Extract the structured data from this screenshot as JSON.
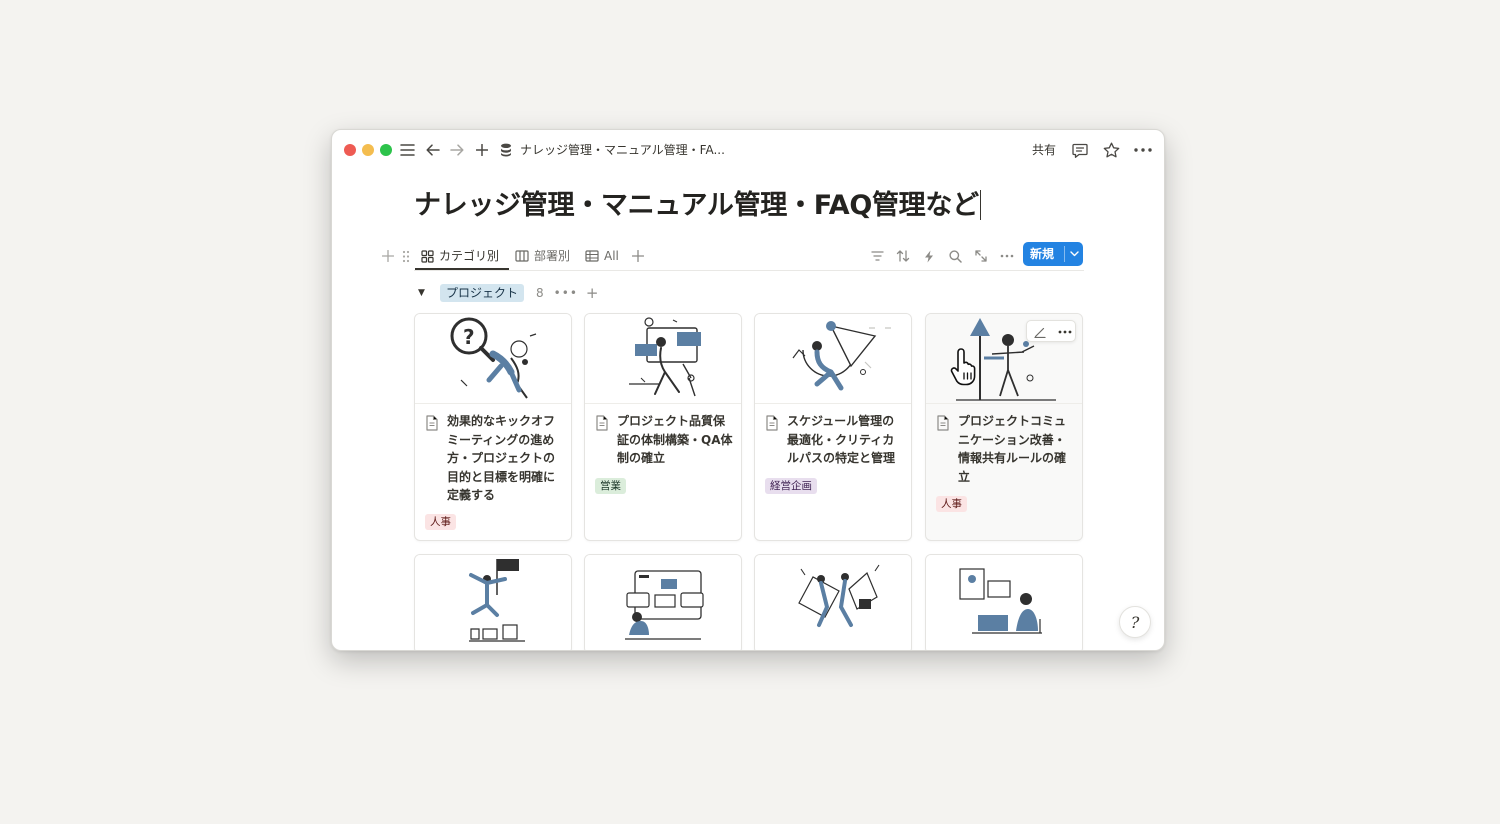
{
  "titlebar": {
    "breadcrumb": "ナレッジ管理・マニュアル管理・FA...",
    "share_label": "共有",
    "icons": [
      "menu-icon",
      "back-arrow-icon",
      "forward-arrow-icon",
      "plus-icon",
      "database-icon",
      "comment-icon",
      "star-icon",
      "more-icon"
    ]
  },
  "page": {
    "title": "ナレッジ管理・マニュアル管理・FAQ管理など"
  },
  "views": {
    "tabs": [
      {
        "label": "カテゴリ別",
        "icon": "gallery-icon",
        "active": true
      },
      {
        "label": "部署別",
        "icon": "board-icon",
        "active": false
      },
      {
        "label": "All",
        "icon": "table-icon",
        "active": false
      }
    ],
    "new_label": "新規",
    "tools": [
      "filter-icon",
      "sort-icon",
      "automation-icon",
      "search-icon",
      "expand-icon",
      "more-icon"
    ]
  },
  "group": {
    "name": "プロジェクト",
    "count": "8"
  },
  "cards": [
    {
      "title": "効果的なキックオフミーティングの進め方・プロジェクトの目的と目標を明確に定義する",
      "tag": "人事",
      "tag_color": "#fbe4e4"
    },
    {
      "title": "プロジェクト品質保証の体制構築・QA体制の確立",
      "tag": "営業",
      "tag_color": "#dbeddb"
    },
    {
      "title": "スケジュール管理の最適化・クリティカルパスの特定と管理",
      "tag": "経営企画",
      "tag_color": "#e8deee"
    },
    {
      "title": "プロジェクトコミュニケーション改善・情報共有ルールの確立",
      "tag": "人事",
      "tag_color": "#fbe4e4"
    }
  ],
  "colors": {
    "accent": "#2383e2",
    "illustration": "#5b7fa3",
    "ink": "#2f2f2f"
  }
}
